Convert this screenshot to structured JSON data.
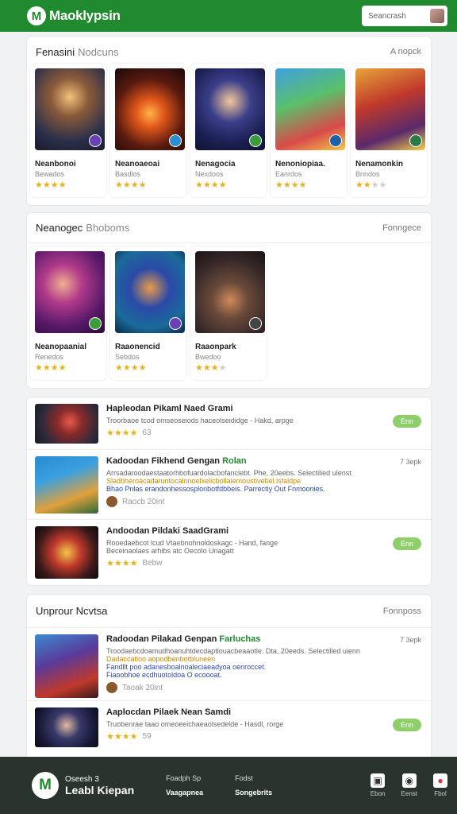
{
  "header": {
    "logo_glyph": "M",
    "brand": "Maoklypsin",
    "search_placeholder": "Seancrash"
  },
  "section1": {
    "title": "Fenasini",
    "subtitle": "Nodcuns",
    "link": "A nopck",
    "items": [
      {
        "name": "Neanbonoi",
        "sub": "Bewados",
        "stars": 4,
        "badge": "#6b3fb5"
      },
      {
        "name": "Neanoaeoai",
        "sub": "Basdlos",
        "stars": 4,
        "badge": "#2a8fd0"
      },
      {
        "name": "Nenagocia",
        "sub": "Nexdoos",
        "stars": 4,
        "badge": "#3a9d3a"
      },
      {
        "name": "Nenoniopiaa.",
        "sub": "Eanrdos",
        "stars": 4,
        "badge": "#1f5fa8"
      },
      {
        "name": "Nenamonkin",
        "sub": "Bnndos",
        "stars": 2.5,
        "badge": "#2b7a4a"
      }
    ]
  },
  "section2": {
    "title": "Neanogec",
    "subtitle": "Bhoboms",
    "link": "Fonngece",
    "items": [
      {
        "name": "Neanopaanial",
        "sub": "Renedos",
        "stars": 4,
        "badge": "#3a9d3a"
      },
      {
        "name": "Raaonencid",
        "sub": "Sebdos",
        "stars": 4,
        "badge": "#6b3fb5"
      },
      {
        "name": "Raaonpark",
        "sub": "Bwedoo",
        "stars": 3.5,
        "badge": "#444444"
      }
    ]
  },
  "section3": {
    "rows": [
      {
        "title": "Hapleodan Pikaml Naed Grami",
        "title_hl": "",
        "desc": "Troorbaoe tcod omseoseiods haceolseididge - Hakd, arpge",
        "rating": "★★★★",
        "meta": "63",
        "pill": "Enn"
      },
      {
        "title": "Kadoodan Fikhend Gengan",
        "title_hl": "Rolan",
        "desc": "Arrsadaroodaestaatorhbofuardolacbofanclebt. Phe, 20eebs. Selectilied ulenst",
        "desc2": "Sladbheroacadaruntocalnnoelxelicbollaiemoustivebel.lsfaldpe",
        "desc3": "Bhao Pnlas erandonhessosplonbotfdbbeis. Parrectiy Out Fnmoonies.",
        "meta": "Raocb 20int",
        "side": "7 3epk"
      },
      {
        "title": "Andoodan Pildaki SaadGrami",
        "title_hl": "",
        "desc": "Rooedaebcot lcud Vtaebnohnoldoskagc - Hand, fange",
        "desc2b": "Beceinaolaes arhibs atc Oecolo Unagatt",
        "rating": "★★★★",
        "meta": "Bebw",
        "pill": "Enn"
      }
    ]
  },
  "section4": {
    "title": "Unprour Ncvtsa",
    "link": "Fonnposs",
    "rows": [
      {
        "title": "Radoodan Pilakad Genpan",
        "title_hl": "Farluchas",
        "desc": "Troodaebcdoamudhoanuhtdecdaptlouacbeaaotle. Dta, 20eeds. Selectilied uienn",
        "desc2": "Dadaccatloo aopodbenbotbluneen",
        "desc3": "Fandllt poo adanesboalnoaleciaeadyoa oenroccet.",
        "desc3b": "Fiaoobhoe ecdhuotoldoa O ecoooat.",
        "meta": "Taoak 20int",
        "side": "7 3epk"
      },
      {
        "title": "Aaplocdan Pilaek Nean Samdi",
        "title_hl": "",
        "desc": "Truobenrae taao omeoeeichaeaolsedelde - Hasdl, rorge",
        "rating": "★★★★",
        "meta": "59",
        "pill": "Enn"
      }
    ]
  },
  "footer": {
    "logo_glyph": "M",
    "brand_top": "Oseesh 3",
    "brand": "Leabl Kiepan",
    "col1_top": "Foadph Sp",
    "col1_bottom": "Vaagapnea",
    "col2_top": "Fodst",
    "col2_bottom": "Songebrits",
    "icons": [
      {
        "glyph": "▣",
        "label": "Ebon"
      },
      {
        "glyph": "◉",
        "label": "Eenst"
      },
      {
        "glyph": "●",
        "label": "Fbol"
      }
    ]
  },
  "colors": {
    "brand_green": "#1f8a2e",
    "footer_bg": "#2a332e",
    "star": "#e4b21b",
    "pill": "#8fcf6b"
  }
}
